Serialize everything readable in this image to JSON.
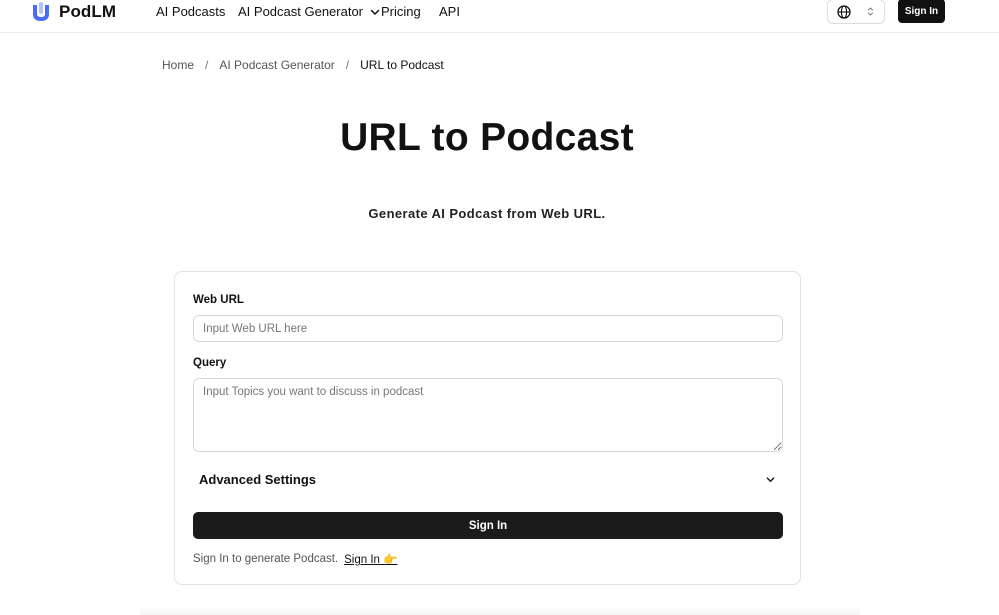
{
  "brand": {
    "name": "PodLM"
  },
  "nav": {
    "items": [
      {
        "label": "AI Podcasts"
      },
      {
        "label": "AI Podcast Generator",
        "has_dropdown": true
      },
      {
        "label": "Pricing"
      },
      {
        "label": "API"
      }
    ],
    "language_icon": "globe-icon",
    "sign_in_label": "Sign In"
  },
  "breadcrumb": {
    "items": [
      "Home",
      "AI Podcast Generator",
      "URL to Podcast"
    ],
    "separator": "/"
  },
  "page": {
    "title": "URL to Podcast",
    "subtitle": "Generate AI Podcast from Web URL."
  },
  "form": {
    "web_url": {
      "label": "Web URL",
      "value": "",
      "placeholder": "Input Web URL here"
    },
    "query": {
      "label": "Query",
      "value": "",
      "placeholder": "Input Topics you want to discuss in podcast"
    },
    "advanced_label": "Advanced Settings",
    "submit_label": "Sign In",
    "footer_text": "Sign In to generate Podcast.",
    "footer_link": "Sign In 👉"
  },
  "colors": {
    "primary_button": "#1b1b1b",
    "logo_blue": "#4a6cf7",
    "logo_light": "#b3c3ff"
  }
}
